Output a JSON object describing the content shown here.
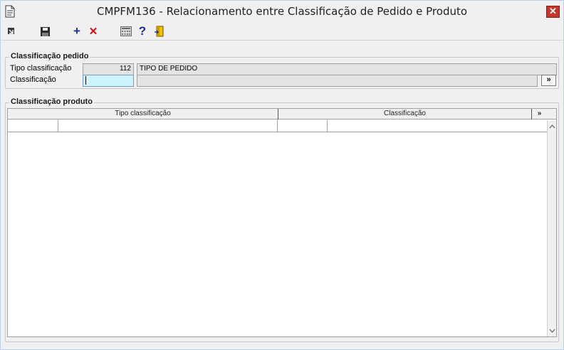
{
  "window": {
    "title": "CMPFM136 - Relacionamento entre Classificação de Pedido e Produto",
    "close_label": "✕"
  },
  "toolbar": {
    "buttons": [
      {
        "icon": "exit-arrow-icon"
      },
      {
        "icon": "save-icon"
      },
      {
        "icon": "add-icon",
        "glyph": "+"
      },
      {
        "icon": "delete-icon",
        "glyph": "✕"
      },
      {
        "icon": "calculator-icon"
      },
      {
        "icon": "help-icon",
        "glyph": "?"
      },
      {
        "icon": "door-exit-icon"
      }
    ]
  },
  "classificacao_pedido": {
    "group_title": "Classificação pedido",
    "tipo_label": "Tipo classificação",
    "tipo_code": "112",
    "tipo_desc": "TIPO DE PEDIDO",
    "classificacao_label": "Classificação",
    "classificacao_value": "",
    "classificacao_desc": "",
    "lookup_label": "»"
  },
  "classificacao_produto": {
    "group_title": "Classificação produto",
    "columns": [
      "Tipo classificação",
      "Classificação"
    ],
    "expand_label": "»",
    "rows": [
      {
        "tipo_code": "",
        "tipo_desc": "",
        "class_code": "",
        "class_desc": ""
      }
    ]
  },
  "colors": {
    "input_active": "#cdf3ff",
    "close_button": "#c0392b",
    "window_bg": "#f0f0f0"
  }
}
